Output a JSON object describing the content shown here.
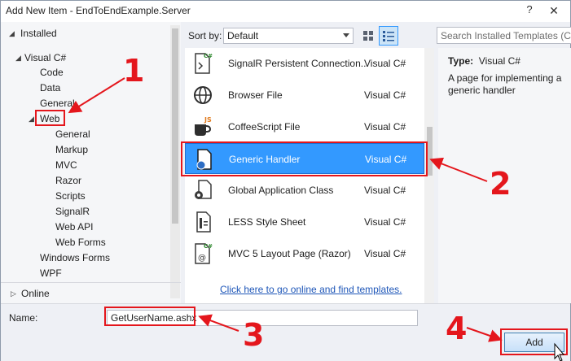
{
  "window": {
    "title": "Add New Item - EndToEndExample.Server",
    "help": "?",
    "close": "✕"
  },
  "tree": {
    "installed": "Installed",
    "items": [
      "Visual C#",
      "Code",
      "Data",
      "General",
      "Web",
      "General",
      "Markup",
      "MVC",
      "Razor",
      "Scripts",
      "SignalR",
      "Web API",
      "Web Forms",
      "Windows Forms",
      "WPF"
    ],
    "online": "Online"
  },
  "toolbar": {
    "sort_label": "Sort by:",
    "sort_value": "Default",
    "search_placeholder": "Search Installed Templates (Ctrl+E)"
  },
  "templates": [
    {
      "name": "SignalR Persistent Connection...",
      "lang": "Visual C#",
      "icon": "signalr-icon"
    },
    {
      "name": "Browser File",
      "lang": "Visual C#",
      "icon": "globe-icon"
    },
    {
      "name": "CoffeeScript File",
      "lang": "Visual C#",
      "icon": "coffee-icon"
    },
    {
      "name": "Generic Handler",
      "lang": "Visual C#",
      "icon": "handler-icon"
    },
    {
      "name": "Global Application Class",
      "lang": "Visual C#",
      "icon": "gear-page-icon"
    },
    {
      "name": "LESS Style Sheet",
      "lang": "Visual C#",
      "icon": "stylesheet-icon"
    },
    {
      "name": "MVC 5 Layout Page (Razor)",
      "lang": "Visual C#",
      "icon": "razor-icon"
    }
  ],
  "online_link": "Click here to go online and find templates.",
  "info": {
    "type_label": "Type:",
    "type_value": "Visual C#",
    "description": "A page for implementing a generic handler"
  },
  "name_field": {
    "label": "Name:",
    "value": "GetUserName.ashx"
  },
  "add_button": "Add",
  "annotations": {
    "n1": "1",
    "n2": "2",
    "n3": "3",
    "n4": "4"
  },
  "colors": {
    "selection": "#3399ff",
    "annotation": "#e4161c",
    "link": "#1e56b8"
  }
}
